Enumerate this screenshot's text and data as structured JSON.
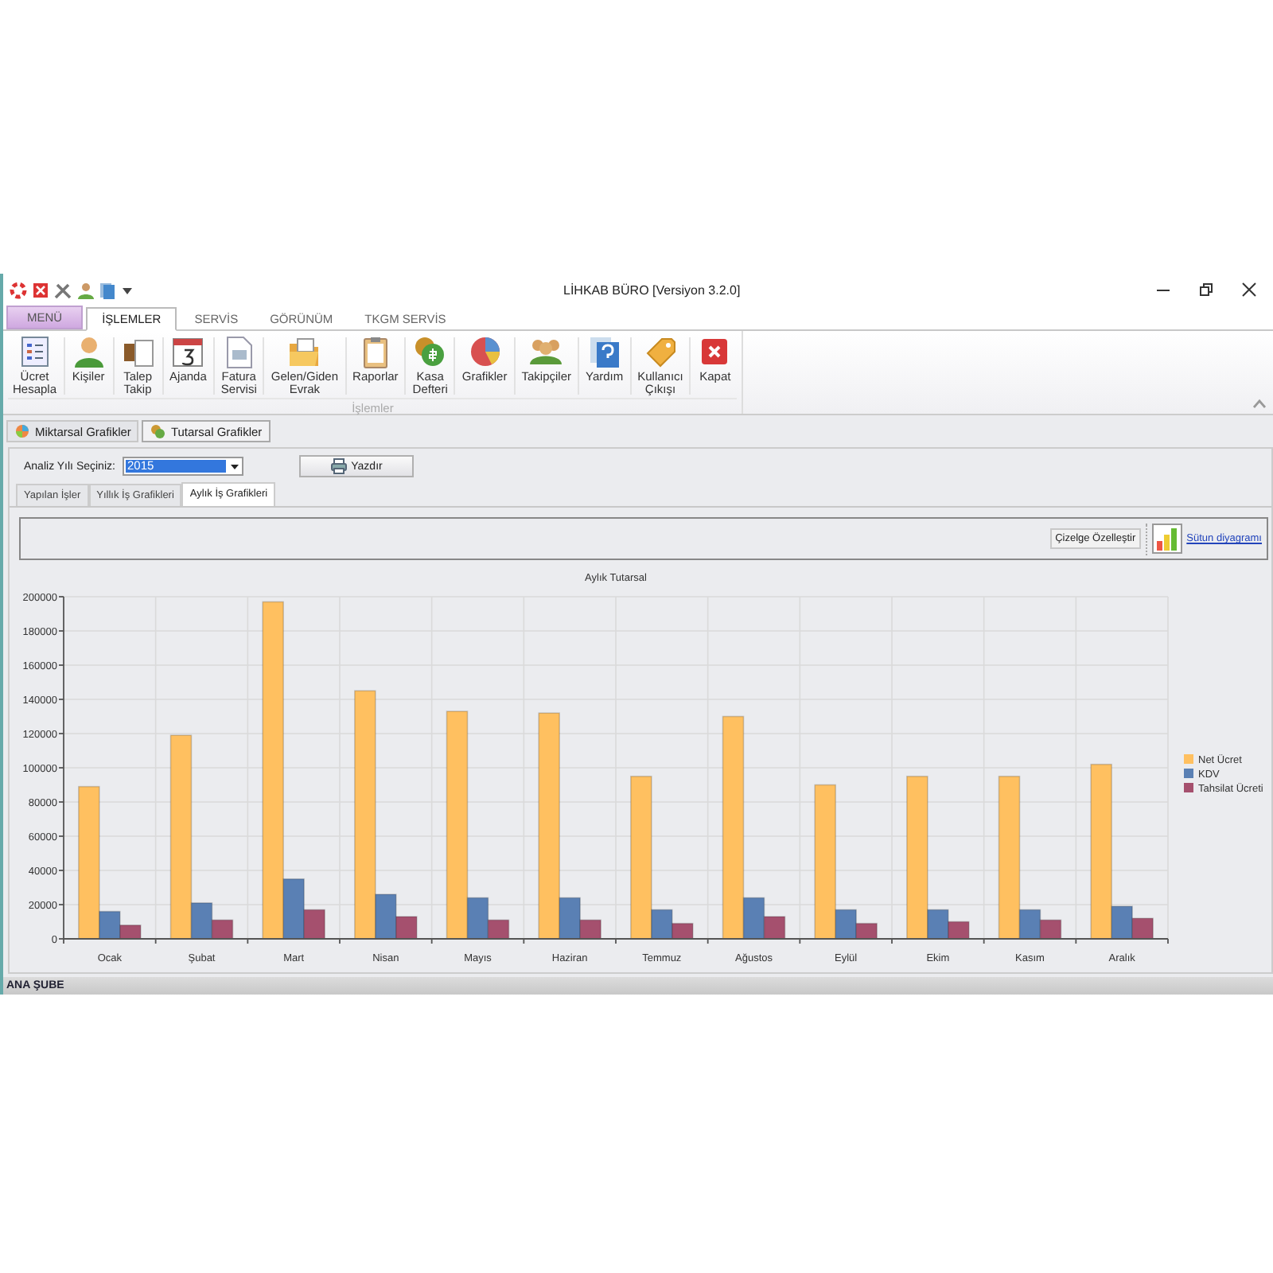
{
  "window": {
    "title": "LİHKAB BÜRO [Versiyon 3.2.0]"
  },
  "ribbon_tabs": [
    {
      "label": "MENÜ",
      "kind": "menu",
      "selected": false
    },
    {
      "label": "İŞLEMLER",
      "kind": "tab",
      "selected": true
    },
    {
      "label": "SERVİS",
      "kind": "tab",
      "selected": false
    },
    {
      "label": "GÖRÜNÜM",
      "kind": "tab",
      "selected": false
    },
    {
      "label": "TKGM SERVİS",
      "kind": "tab",
      "selected": false
    }
  ],
  "ribbon": {
    "group_label": "İşlemler",
    "buttons": [
      {
        "label": "Ücret\nHesapla"
      },
      {
        "label": "Kişiler"
      },
      {
        "label": "Talep\nTakip"
      },
      {
        "label": "Ajanda"
      },
      {
        "label": "Fatura\nServisi"
      },
      {
        "label": "Gelen/Giden\nEvrak"
      },
      {
        "label": "Raporlar"
      },
      {
        "label": "Kasa\nDefteri"
      },
      {
        "label": "Grafikler"
      },
      {
        "label": "Takipçiler"
      },
      {
        "label": "Yardım"
      },
      {
        "label": "Kullanıcı\nÇıkışı"
      },
      {
        "label": "Kapat"
      }
    ]
  },
  "page_tabs": [
    {
      "label": "Miktarsal Grafikler",
      "selected": false
    },
    {
      "label": "Tutarsal Grafikler",
      "selected": true
    }
  ],
  "year_select": {
    "label": "Analiz Yılı Seçiniz:",
    "value": "2015"
  },
  "print_button": "Yazdır",
  "inner_tabs": [
    {
      "label": "Yapılan İşler",
      "selected": false
    },
    {
      "label": "Yıllık İş Grafikleri",
      "selected": false
    },
    {
      "label": "Aylık İş Grafikleri",
      "selected": true
    }
  ],
  "chart_toolbar": {
    "customize_button": "Çizelge Özelleştir",
    "chart_type_link": "Sütun diyagramı"
  },
  "chart_data": {
    "type": "bar",
    "title": "Aylık Tutarsal",
    "categories": [
      "Ocak",
      "Şubat",
      "Mart",
      "Nisan",
      "Mayıs",
      "Haziran",
      "Temmuz",
      "Ağustos",
      "Eylül",
      "Ekim",
      "Kasım",
      "Aralık"
    ],
    "series": [
      {
        "name": "Net Ücret",
        "color": "#ffc060",
        "values": [
          89000,
          119000,
          197000,
          145000,
          133000,
          132000,
          95000,
          130000,
          90000,
          95000,
          95000,
          102000
        ]
      },
      {
        "name": "KDV",
        "color": "#5a80b4",
        "values": [
          16000,
          21000,
          35000,
          26000,
          24000,
          24000,
          17000,
          24000,
          17000,
          17000,
          17000,
          19000
        ]
      },
      {
        "name": "Tahsilat Ücreti",
        "color": "#a5506e",
        "values": [
          8000,
          11000,
          17000,
          13000,
          11000,
          11000,
          9000,
          13000,
          9000,
          10000,
          11000,
          12000
        ]
      }
    ],
    "grid": true,
    "legend": "right",
    "ylim": [
      0,
      200000
    ],
    "yticks": [
      0,
      20000,
      40000,
      60000,
      80000,
      100000,
      120000,
      140000,
      160000,
      180000,
      200000
    ]
  },
  "status_bar": "ANA ŞUBE"
}
